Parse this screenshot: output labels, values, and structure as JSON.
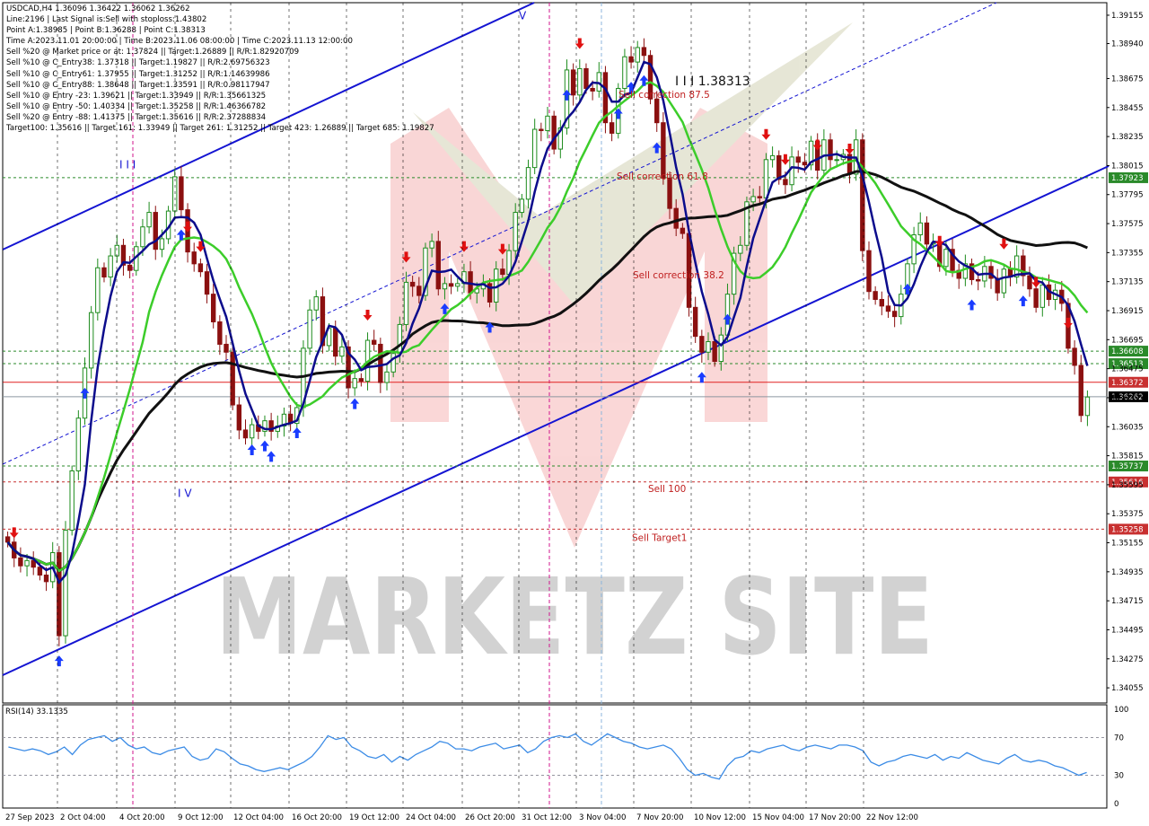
{
  "header": {
    "lines": [
      "USDCAD,H4  1.36096 1.36422 1.36062 1.36262",
      "Line:2196 | Last Signal is:Sell with stoploss:1.43802",
      "Point A:1.38985 | Point B:1.36288 | Point C:1.38313",
      "Time A:2023.11.01 20:00:00 | Time B:2023.11.06 08:00:00 | Time C:2023.11.13 12:00:00",
      "Sell %20 @ Market price or at: 1.37824 || Target:1.26889 || R/R:1.82920709",
      "Sell %10 @ C_Entry38: 1.37318 || Target:1.19827 || R/R:2.69756323",
      "Sell %10 @ C_Entry61: 1.37955 || Target:1.31252 || R/R:1.14639986",
      "Sell %10 @ C_Entry88: 1.38648 || Target:1.33591 || R/R:0.98117947",
      "Sell %10 @ Entry -23: 1.39621 || Target:1.33949 || R/R:1.35661325",
      "Sell %10 @ Entry -50: 1.40334 || Target:1.35258 || R/R:1.46366782",
      "Sell %20 @ Entry -88: 1.41375 || Target:1.35616 || R/R:2.37288834",
      "Target100: 1.35616 || Target 161: 1.33949 || Target 261: 1.31252 || Target 423: 1.26889 || Target 685: 1.19827"
    ]
  },
  "rsi_label": "RSI(14) 33.1335",
  "watermark": "MARKETZ SITE",
  "colors": {
    "bull": "#1e8c1e",
    "bear": "#8b1010",
    "fast_ma": "#0c0c8c",
    "mid_ma": "#3ccd2a",
    "slow_ma": "#111111",
    "channel": "#1414d2",
    "buy_arrow": "#1a3cff",
    "sell_arrow": "#e01010",
    "green_level": "#2a8a2a",
    "red_level": "#c83030",
    "rsi": "#3c8ce6"
  },
  "chart_data": [
    {
      "type": "candlestick",
      "symbol": "USDCAD",
      "timeframe": "H4",
      "ohlc_last": {
        "open": 1.36096,
        "high": 1.36422,
        "low": 1.36062,
        "close": 1.36262
      },
      "ylim": [
        1.3394,
        1.3925
      ],
      "y_ticks": [
        1.39155,
        1.3894,
        1.38675,
        1.38455,
        1.38235,
        1.38015,
        1.37795,
        1.37575,
        1.37355,
        1.37135,
        1.36915,
        1.36695,
        1.36475,
        1.36255,
        1.36035,
        1.35815,
        1.35595,
        1.35375,
        1.35155,
        1.34935,
        1.34715,
        1.34495,
        1.34275,
        1.34055
      ],
      "x_labels": [
        "27 Sep 2023",
        "2 Oct 04:00",
        "4 Oct 20:00",
        "9 Oct 12:00",
        "12 Oct 04:00",
        "16 Oct 20:00",
        "19 Oct 12:00",
        "24 Oct 04:00",
        "26 Oct 20:00",
        "31 Oct 12:00",
        "3 Nov 04:00",
        "7 Nov 20:00",
        "10 Nov 12:00",
        "15 Nov 04:00",
        "17 Nov 20:00",
        "22 Nov 12:00"
      ],
      "levels": [
        {
          "price": 1.37923,
          "label": "1.37923",
          "color": "green"
        },
        {
          "price": 1.36608,
          "label": "1.36608",
          "color": "green"
        },
        {
          "price": 1.36513,
          "label": "1.36513",
          "color": "green"
        },
        {
          "price": 1.36372,
          "label": "1.36372",
          "color": "red"
        },
        {
          "price": 1.36262,
          "label": "1.36262",
          "color": "current"
        },
        {
          "price": 1.35737,
          "label": "1.35737",
          "color": "green"
        },
        {
          "price": 1.35616,
          "label": "1.35616",
          "color": "red"
        },
        {
          "price": 1.35258,
          "label": "1.35258",
          "color": "red"
        }
      ],
      "annotations": [
        {
          "text": "Sell correction 87.5",
          "price": 1.3855
        },
        {
          "text": "Sell correction 61.8",
          "price": 1.3793
        },
        {
          "text": "Sell correction 38.2",
          "price": 1.3718
        },
        {
          "text": "Sell 100",
          "price": 1.3556
        },
        {
          "text": "Sell Target1",
          "price": 1.3519
        }
      ],
      "point_labels": [
        {
          "text": "I I I 1.38313",
          "price": 1.3865
        },
        {
          "text": "I I I",
          "price": 1.3802
        },
        {
          "text": "V",
          "price": 1.3915
        },
        {
          "text": "I V",
          "price": 1.3553
        }
      ],
      "series": [
        {
          "name": "close",
          "values": [
            1.3516,
            1.3504,
            1.3498,
            1.3502,
            1.3497,
            1.3491,
            1.3486,
            1.3508,
            1.3445,
            1.3525,
            1.357,
            1.361,
            1.3648,
            1.369,
            1.3724,
            1.3717,
            1.3733,
            1.3741,
            1.3726,
            1.3722,
            1.374,
            1.3755,
            1.3766,
            1.3738,
            1.3746,
            1.3767,
            1.3793,
            1.3768,
            1.3736,
            1.3727,
            1.3721,
            1.3704,
            1.3683,
            1.3666,
            1.366,
            1.362,
            1.3601,
            1.3595,
            1.3605,
            1.36,
            1.3608,
            1.36,
            1.3604,
            1.3613,
            1.3606,
            1.3618,
            1.3663,
            1.3692,
            1.3702,
            1.3665,
            1.3678,
            1.3657,
            1.3664,
            1.3633,
            1.364,
            1.3638,
            1.3669,
            1.3666,
            1.3637,
            1.3645,
            1.3659,
            1.3681,
            1.3713,
            1.371,
            1.3703,
            1.3739,
            1.3744,
            1.3708,
            1.3712,
            1.371,
            1.3712,
            1.3721,
            1.3705,
            1.3708,
            1.3712,
            1.3698,
            1.3723,
            1.3719,
            1.3737,
            1.3766,
            1.3776,
            1.38,
            1.3829,
            1.3828,
            1.3839,
            1.3814,
            1.383,
            1.3874,
            1.3855,
            1.3875,
            1.386,
            1.3858,
            1.3872,
            1.3834,
            1.3826,
            1.386,
            1.3884,
            1.388,
            1.3891,
            1.3885,
            1.3852,
            1.3834,
            1.3792,
            1.3769,
            1.3754,
            1.375,
            1.3694,
            1.3672,
            1.366,
            1.3668,
            1.3653,
            1.3673,
            1.3704,
            1.3735,
            1.3741,
            1.3774,
            1.3778,
            1.3777,
            1.3806,
            1.3809,
            1.3791,
            1.3787,
            1.3808,
            1.3804,
            1.3802,
            1.382,
            1.3798,
            1.3821,
            1.3806,
            1.3806,
            1.381,
            1.3795,
            1.3821,
            1.3737,
            1.3706,
            1.37,
            1.3695,
            1.3691,
            1.3687,
            1.3704,
            1.3727,
            1.3749,
            1.3758,
            1.3742,
            1.3743,
            1.3725,
            1.3738,
            1.3722,
            1.3716,
            1.3727,
            1.3715,
            1.3714,
            1.3725,
            1.3716,
            1.3705,
            1.3723,
            1.3717,
            1.3733,
            1.3718,
            1.3708,
            1.3694,
            1.3711,
            1.37,
            1.3707,
            1.3697,
            1.3663,
            1.365,
            1.3612,
            1.3626
          ]
        },
        {
          "name": "RSI(14)",
          "values": [
            60,
            58,
            56,
            58,
            56,
            52,
            55,
            60,
            52,
            62,
            68,
            70,
            72,
            66,
            70,
            62,
            58,
            60,
            54,
            52,
            56,
            58,
            60,
            50,
            46,
            48,
            58,
            55,
            48,
            42,
            40,
            36,
            34,
            36,
            38,
            36,
            40,
            44,
            50,
            60,
            72,
            68,
            70,
            60,
            56,
            50,
            48,
            52,
            44,
            50,
            46,
            52,
            56,
            60,
            66,
            64,
            58,
            58,
            56,
            60,
            62,
            64,
            58,
            60,
            62,
            54,
            58,
            66,
            70,
            72,
            70,
            74,
            66,
            62,
            68,
            74,
            70,
            66,
            64,
            60,
            58,
            60,
            62,
            58,
            48,
            36,
            30,
            32,
            28,
            26,
            40,
            48,
            50,
            56,
            54,
            58,
            60,
            62,
            58,
            56,
            60,
            62,
            60,
            58,
            62,
            62,
            60,
            56,
            44,
            40,
            44,
            46,
            50,
            52,
            50,
            48,
            52,
            46,
            50,
            48,
            54,
            50,
            46,
            44,
            42,
            48,
            52,
            46,
            44,
            46,
            44,
            40,
            38,
            34,
            30,
            33
          ]
        }
      ]
    },
    {
      "type": "line",
      "name": "RSI(14)",
      "ylim": [
        0,
        100
      ],
      "y_ticks": [
        100,
        70,
        30,
        0
      ],
      "levels": [
        70,
        30
      ]
    }
  ]
}
